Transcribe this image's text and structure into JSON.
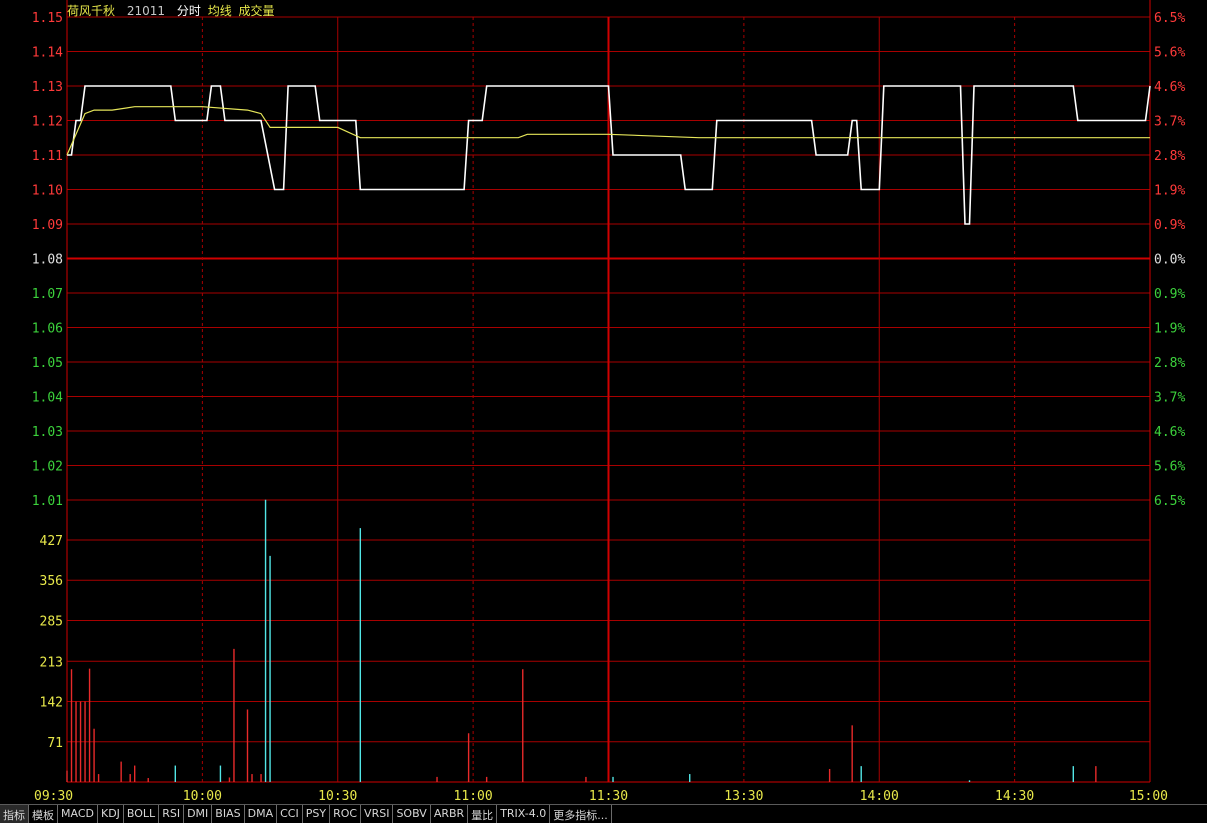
{
  "header": {
    "stock_name": "荷风千秋",
    "code": "21011",
    "label_time": "分时",
    "label_avg": "均线",
    "label_volume": "成交量"
  },
  "colors": {
    "grid": "#a80000",
    "grid_major": "#d00000",
    "up": "#ff3a3a",
    "down": "#3cd23c",
    "flat": "#e0e0e0",
    "price_line": "#ffffff",
    "avg_line": "#e6e65a",
    "vol_up": "#e82a2a",
    "vol_down": "#52e6e6",
    "vol_axis": "#e8e84a",
    "time_label": "#e8e84a",
    "title_name": "#e8e84a",
    "title_code": "#c8c8c8"
  },
  "chart_data": {
    "type": "line",
    "prev_close": 1.08,
    "price_axis": {
      "ylim": [
        1.01,
        1.15
      ],
      "ticks": [
        "1.15",
        "1.14",
        "1.13",
        "1.12",
        "1.11",
        "1.10",
        "1.09",
        "1.08",
        "1.07",
        "1.06",
        "1.05",
        "1.04",
        "1.03",
        "1.02",
        "1.01"
      ],
      "pct_labels": [
        "6.5%",
        "5.6%",
        "4.6%",
        "3.7%",
        "2.8%",
        "1.9%",
        "0.9%",
        "0.0%",
        "0.9%",
        "1.9%",
        "2.8%",
        "3.7%",
        "4.6%",
        "5.6%",
        "6.5%"
      ]
    },
    "volume_axis": {
      "ylim": [
        0,
        427
      ],
      "ticks": [
        "427",
        "356",
        "285",
        "213",
        "142",
        "71"
      ]
    },
    "time_axis": {
      "labels": [
        "09:30",
        "10:00",
        "10:30",
        "11:00",
        "11:30",
        "13:30",
        "14:00",
        "14:30",
        "15:00"
      ],
      "minutes": [
        0,
        30,
        60,
        90,
        120,
        150,
        180,
        210,
        240
      ]
    },
    "series": [
      {
        "name": "分时",
        "points": [
          [
            0,
            1.11
          ],
          [
            1,
            1.11
          ],
          [
            2,
            1.12
          ],
          [
            3,
            1.12
          ],
          [
            4,
            1.13
          ],
          [
            23,
            1.13
          ],
          [
            24,
            1.12
          ],
          [
            31,
            1.12
          ],
          [
            32,
            1.13
          ],
          [
            34,
            1.13
          ],
          [
            35,
            1.12
          ],
          [
            43,
            1.12
          ],
          [
            46,
            1.1
          ],
          [
            48,
            1.1
          ],
          [
            49,
            1.13
          ],
          [
            55,
            1.13
          ],
          [
            56,
            1.12
          ],
          [
            64,
            1.12
          ],
          [
            65,
            1.1
          ],
          [
            88,
            1.1
          ],
          [
            89,
            1.12
          ],
          [
            92,
            1.12
          ],
          [
            93,
            1.13
          ],
          [
            120,
            1.13
          ],
          [
            121,
            1.11
          ],
          [
            136,
            1.11
          ],
          [
            137,
            1.1
          ],
          [
            143,
            1.1
          ],
          [
            144,
            1.12
          ],
          [
            165,
            1.12
          ],
          [
            166,
            1.11
          ],
          [
            173,
            1.11
          ],
          [
            174,
            1.12
          ],
          [
            175,
            1.12
          ],
          [
            176,
            1.1
          ],
          [
            180,
            1.1
          ],
          [
            181,
            1.13
          ],
          [
            198,
            1.13
          ],
          [
            199,
            1.09
          ],
          [
            200,
            1.09
          ],
          [
            201,
            1.13
          ],
          [
            223,
            1.13
          ],
          [
            224,
            1.12
          ],
          [
            239,
            1.12
          ],
          [
            240,
            1.13
          ]
        ]
      },
      {
        "name": "均线",
        "points": [
          [
            0,
            1.11
          ],
          [
            2,
            1.116
          ],
          [
            4,
            1.122
          ],
          [
            6,
            1.123
          ],
          [
            10,
            1.123
          ],
          [
            15,
            1.124
          ],
          [
            30,
            1.124
          ],
          [
            40,
            1.123
          ],
          [
            43,
            1.122
          ],
          [
            45,
            1.118
          ],
          [
            50,
            1.118
          ],
          [
            55,
            1.118
          ],
          [
            60,
            1.118
          ],
          [
            65,
            1.115
          ],
          [
            90,
            1.115
          ],
          [
            100,
            1.115
          ],
          [
            102,
            1.116
          ],
          [
            120,
            1.116
          ],
          [
            140,
            1.115
          ],
          [
            180,
            1.115
          ],
          [
            210,
            1.115
          ],
          [
            240,
            1.115
          ]
        ]
      }
    ],
    "volume": [
      {
        "t": 0,
        "v": 20,
        "dir": "up"
      },
      {
        "t": 1,
        "v": 199,
        "dir": "up"
      },
      {
        "t": 2,
        "v": 142,
        "dir": "up"
      },
      {
        "t": 3,
        "v": 142,
        "dir": "up"
      },
      {
        "t": 4,
        "v": 142,
        "dir": "up"
      },
      {
        "t": 5,
        "v": 200,
        "dir": "up"
      },
      {
        "t": 6,
        "v": 94,
        "dir": "up"
      },
      {
        "t": 7,
        "v": 14,
        "dir": "up"
      },
      {
        "t": 12,
        "v": 36,
        "dir": "up"
      },
      {
        "t": 14,
        "v": 14,
        "dir": "up"
      },
      {
        "t": 15,
        "v": 29,
        "dir": "up"
      },
      {
        "t": 18,
        "v": 7,
        "dir": "up"
      },
      {
        "t": 24,
        "v": 29,
        "dir": "down"
      },
      {
        "t": 34,
        "v": 29,
        "dir": "down"
      },
      {
        "t": 36,
        "v": 8,
        "dir": "up"
      },
      {
        "t": 37,
        "v": 235,
        "dir": "up"
      },
      {
        "t": 40,
        "v": 128,
        "dir": "up"
      },
      {
        "t": 41,
        "v": 14,
        "dir": "up"
      },
      {
        "t": 43,
        "v": 14,
        "dir": "up"
      },
      {
        "t": 44,
        "v": 498,
        "dir": "down"
      },
      {
        "t": 45,
        "v": 399,
        "dir": "down"
      },
      {
        "t": 65,
        "v": 448,
        "dir": "down"
      },
      {
        "t": 82,
        "v": 9,
        "dir": "up"
      },
      {
        "t": 89,
        "v": 86,
        "dir": "up"
      },
      {
        "t": 93,
        "v": 9,
        "dir": "up"
      },
      {
        "t": 101,
        "v": 199,
        "dir": "up"
      },
      {
        "t": 115,
        "v": 9,
        "dir": "up"
      },
      {
        "t": 121,
        "v": 9,
        "dir": "down"
      },
      {
        "t": 138,
        "v": 14,
        "dir": "down"
      },
      {
        "t": 169,
        "v": 23,
        "dir": "up"
      },
      {
        "t": 174,
        "v": 100,
        "dir": "up"
      },
      {
        "t": 176,
        "v": 28,
        "dir": "down"
      },
      {
        "t": 200,
        "v": 3,
        "dir": "down"
      },
      {
        "t": 223,
        "v": 28,
        "dir": "down"
      },
      {
        "t": 228,
        "v": 28,
        "dir": "up"
      }
    ]
  },
  "tabs": [
    "指标",
    "模板",
    "MACD",
    "KDJ",
    "BOLL",
    "RSI",
    "DMI",
    "BIAS",
    "DMA",
    "CCI",
    "PSY",
    "ROC",
    "VRSI",
    "SOBV",
    "ARBR",
    "量比",
    "TRIX-4.0",
    "更多指标..."
  ]
}
